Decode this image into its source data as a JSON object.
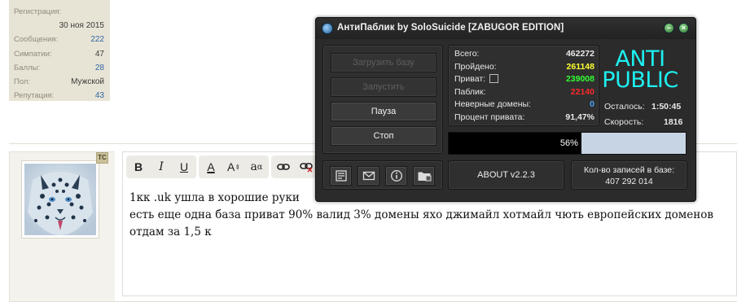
{
  "profile": {
    "registration_label": "Регистрация:",
    "registration_date": "30 ноя 2015",
    "rows": [
      {
        "label": "Сообщения:",
        "value": "222",
        "link": true
      },
      {
        "label": "Симпатии:",
        "value": "47",
        "link": false
      },
      {
        "label": "Баллы:",
        "value": "28",
        "link": true
      },
      {
        "label": "Пол:",
        "value": "Мужской",
        "link": false
      },
      {
        "label": "Репутация:",
        "value": "43",
        "link": true
      }
    ]
  },
  "post": {
    "ts_badge": "ТС",
    "toolbar": {
      "bold": "B",
      "italic": "I",
      "underline": "U",
      "font_color": "A",
      "font_size": "A",
      "font_family": "a",
      "link_icon": "link-icon",
      "unlink_icon": "unlink-icon"
    },
    "lines": [
      "1кк .uk ушла в хорошие руки",
      "есть еще одна база приват 90% валид 3% домены яхо джимайл хотмайл чють европейских доменов",
      "отдам за 1,5 к"
    ]
  },
  "app": {
    "title": "АнтиПаблик by SoloSuicide [ZABUGOR EDITION]",
    "buttons": {
      "load_base": "Загрузить базу",
      "start": "Запустить",
      "pause": "Пауза",
      "stop": "Стоп"
    },
    "stats": {
      "total_label": "Всего:",
      "total_value": "462272",
      "passed_label": "Пройдено:",
      "passed_value": "261148",
      "private_label": "Приват:",
      "private_value": "239008",
      "public_label": "Паблик:",
      "public_value": "22140",
      "bad_domains_label": "Неверные домены:",
      "bad_domains_value": "0",
      "private_percent_label": "Процент привата:",
      "private_percent_value": "91,47%"
    },
    "logo_line1": "ANTI",
    "logo_line2": "PUBLIC",
    "remaining_label": "Осталось:",
    "remaining_value": "1:50:45",
    "speed_label": "Скорость:",
    "speed_value": "1816",
    "progress_text": "56%",
    "progress_fraction": 0.56,
    "about_label": "ABOUT v2.2.3",
    "db_count_label": "Кол-во записей в базе:",
    "db_count_value": "407 292 014",
    "icons": [
      "notes-icon",
      "mail-icon",
      "info-icon",
      "folder-icon"
    ],
    "colors": {
      "passed": "#ffff33",
      "private": "#33ff33",
      "public": "#ff2a2a",
      "bad_domains": "#4aa3ff",
      "logo": "#1ef0f0"
    }
  }
}
